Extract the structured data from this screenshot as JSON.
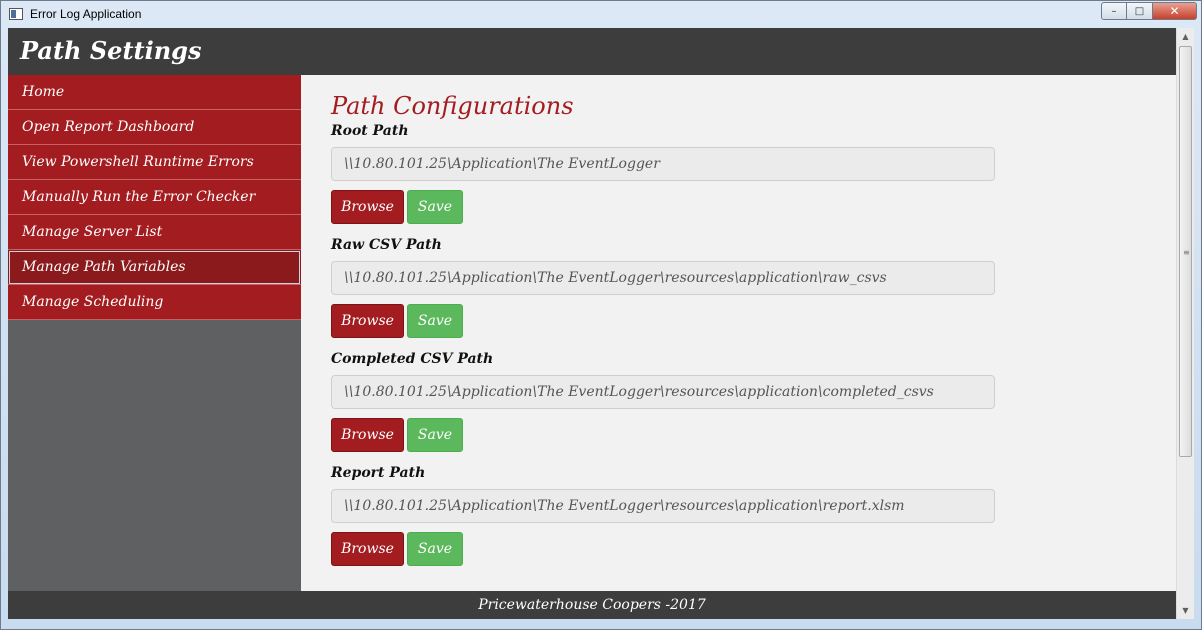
{
  "window": {
    "title": "Error Log Application",
    "buttons": {
      "minimize": "–",
      "maximize": "□",
      "close": "✕"
    }
  },
  "header": {
    "title": "Path Settings"
  },
  "sidebar": {
    "items": [
      {
        "label": "Home"
      },
      {
        "label": "Open Report Dashboard"
      },
      {
        "label": "View Powershell Runtime Errors"
      },
      {
        "label": "Manually Run the Error Checker"
      },
      {
        "label": "Manage Server List"
      },
      {
        "label": "Manage Path Variables",
        "active": true
      },
      {
        "label": "Manage Scheduling"
      }
    ]
  },
  "main": {
    "heading": "Path Configurations",
    "browse_label": "Browse",
    "save_label": "Save",
    "fields": [
      {
        "label": "Root Path",
        "value": "\\\\10.80.101.25\\Application\\The EventLogger"
      },
      {
        "label": "Raw CSV Path",
        "value": "\\\\10.80.101.25\\Application\\The EventLogger\\resources\\application\\raw_csvs"
      },
      {
        "label": "Completed CSV Path",
        "value": "\\\\10.80.101.25\\Application\\The EventLogger\\resources\\application\\completed_csvs"
      },
      {
        "label": "Report Path",
        "value": "\\\\10.80.101.25\\Application\\The EventLogger\\resources\\application\\report.xlsm"
      }
    ]
  },
  "footer": {
    "text": "Pricewaterhouse Coopers -2017"
  },
  "colors": {
    "brand_red": "#a21c20",
    "header_dark": "#3d3d3d",
    "sidebar_gray": "#5f6062",
    "save_green": "#5cb85c"
  },
  "icons": {
    "scroll_up": "▲",
    "scroll_down": "▼",
    "scroll_grip": "≡"
  }
}
